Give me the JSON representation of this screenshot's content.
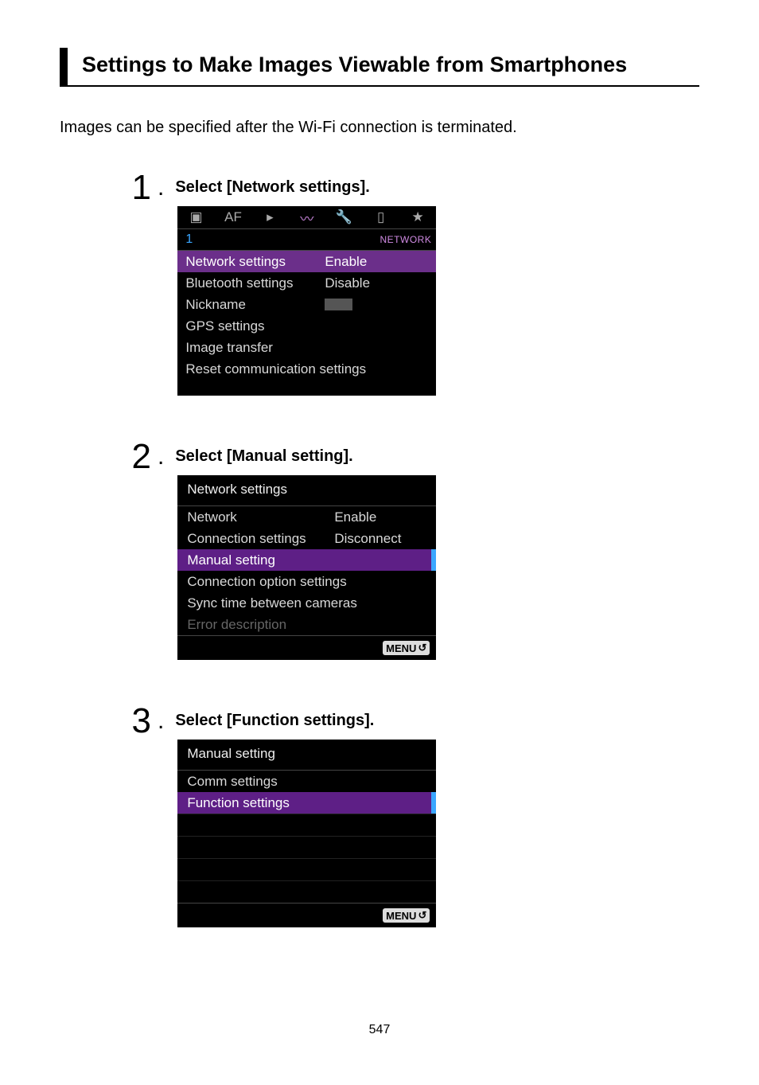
{
  "heading": "Settings to Make Images Viewable from Smartphones",
  "intro": "Images can be specified after the Wi-Fi connection is terminated.",
  "steps": [
    {
      "num": "1",
      "title": "Select [Network settings]."
    },
    {
      "num": "2",
      "title": "Select [Manual setting]."
    },
    {
      "num": "3",
      "title": "Select [Function settings]."
    }
  ],
  "screen1": {
    "tabs": {
      "camera": "camera-icon",
      "af": "AF",
      "play": "play-icon",
      "network": "network-icon",
      "wrench": "wrench-icon",
      "custom": "custom-icon",
      "star": "star-icon"
    },
    "sub_page": "1",
    "group_label": "NETWORK",
    "rows": [
      {
        "label": "Network settings",
        "value": "Enable",
        "selected": true
      },
      {
        "label": "Bluetooth settings",
        "value": "Disable"
      },
      {
        "label": "Nickname",
        "value_box": true
      },
      {
        "label": "GPS settings"
      },
      {
        "label": "Image transfer"
      },
      {
        "label": "Reset communication settings"
      }
    ]
  },
  "screen2": {
    "title": "Network settings",
    "rows": [
      {
        "label": "Network",
        "value": "Enable"
      },
      {
        "label": "Connection settings",
        "value": "Disconnect"
      },
      {
        "label": "Manual setting",
        "selected": true
      },
      {
        "label": "Connection option settings"
      },
      {
        "label": "Sync time between cameras"
      },
      {
        "label": "Error description",
        "disabled": true
      }
    ],
    "footer_btn": "MENU"
  },
  "screen3": {
    "title": "Manual setting",
    "rows": [
      {
        "label": "Comm settings"
      },
      {
        "label": "Function settings",
        "selected": true
      }
    ],
    "footer_btn": "MENU"
  },
  "page_number": "547"
}
